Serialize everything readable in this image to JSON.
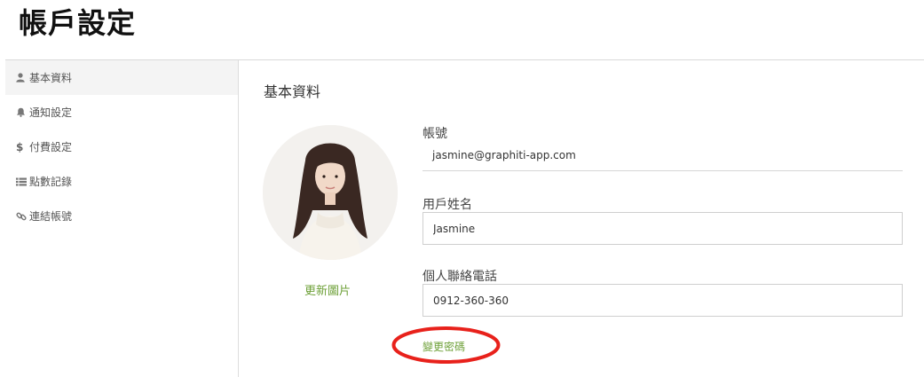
{
  "page": {
    "title": "帳戶設定"
  },
  "sidebar": {
    "items": [
      {
        "label": "基本資料",
        "icon": "user-icon",
        "active": true
      },
      {
        "label": "通知設定",
        "icon": "bell-icon",
        "active": false
      },
      {
        "label": "付費設定",
        "icon": "dollar-icon",
        "active": false
      },
      {
        "label": "點數記錄",
        "icon": "list-icon",
        "active": false
      },
      {
        "label": "連結帳號",
        "icon": "link-icon",
        "active": false
      }
    ]
  },
  "profile": {
    "section_title": "基本資料",
    "update_photo_label": "更新圖片",
    "account_label": "帳號",
    "account_value": "jasmine@graphiti-app.com",
    "username_label": "用戶姓名",
    "username_value": "Jasmine",
    "phone_label": "個人聯絡電話",
    "phone_value": "0912-360-360",
    "change_password_label": "變更密碼"
  },
  "colors": {
    "accent_green": "#6fa13a",
    "annotation_red": "#e8211b",
    "sidebar_active_bg": "#f4f4f4"
  }
}
